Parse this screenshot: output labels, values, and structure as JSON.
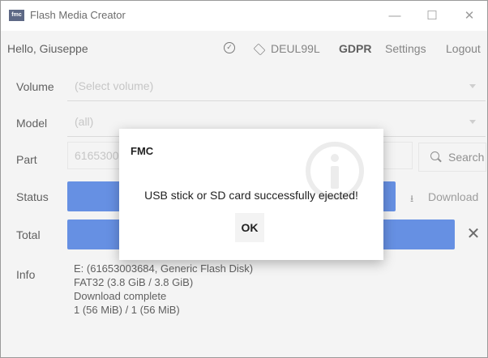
{
  "window": {
    "app_icon": "fmc",
    "title": "Flash Media Creator",
    "minimize_glyph": "—",
    "maximize_glyph": "☐",
    "close_glyph": "✕"
  },
  "header": {
    "greeting": "Hello, Giuseppe",
    "status_icon": "check-circle-icon",
    "user_code": "DEUL99L",
    "gdpr": "GDPR",
    "settings": "Settings",
    "logout": "Logout"
  },
  "form": {
    "volume_label": "Volume",
    "volume_value": "(Select volume)",
    "model_label": "Model",
    "model_value": "(all)",
    "part_label": "Part",
    "part_value": "6165300",
    "search_label": "Search",
    "status_label": "Status",
    "download_label": "Download",
    "total_label": "Total",
    "clear_glyph": "✕",
    "info_label": "Info"
  },
  "progress": {
    "status_fraction": 1.0,
    "total_fraction": 1.0,
    "color": "#2b66d9"
  },
  "info_lines": [
    "E: (61653003684, Generic Flash Disk)",
    "FAT32 (3.8 GiB / 3.8 GiB)",
    "Download complete",
    "1 (56 MiB) / 1 (56 MiB)"
  ],
  "dialog": {
    "title": "FMC",
    "message": "USB stick or SD card successfully ejected!",
    "ok": "OK",
    "icon": "info-icon"
  }
}
